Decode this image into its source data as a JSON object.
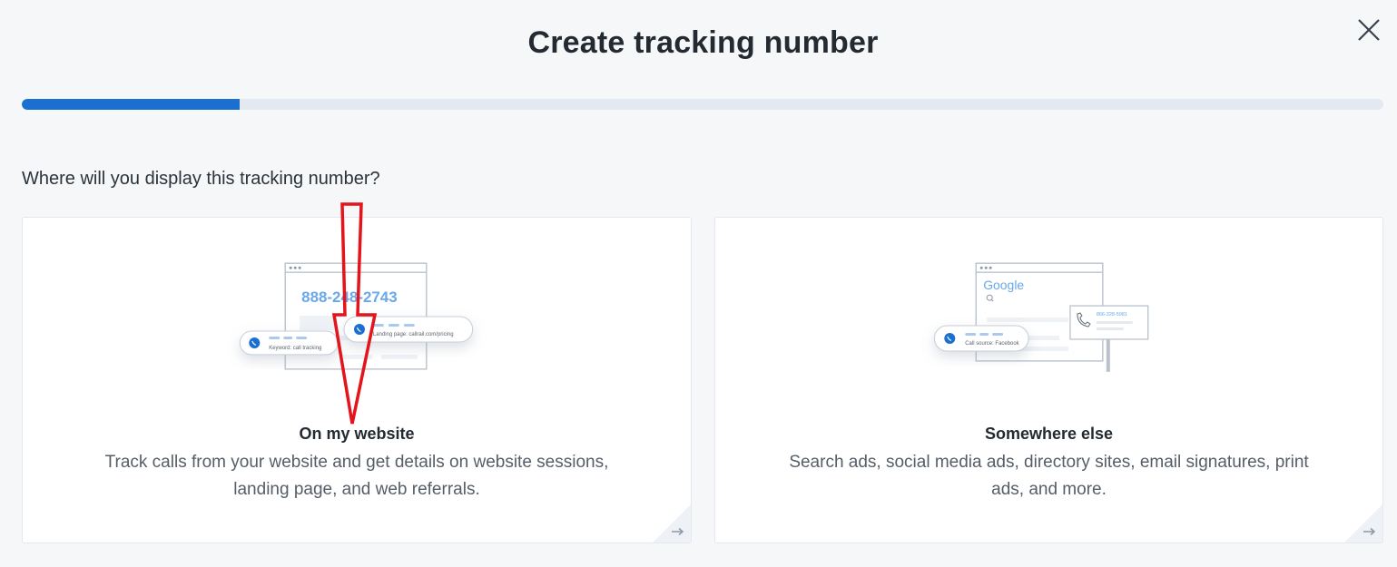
{
  "modal": {
    "title": "Create tracking number",
    "progress_fraction": 0.16
  },
  "question": "Where will you display this tracking number?",
  "options": [
    {
      "title": "On my website",
      "description": "Track calls from your website and get details on website sessions, landing page, and web referrals.",
      "illustration": {
        "phone_number": "888-2¹48-2⁸₈43",
        "number_display": "888-248-2743",
        "chip_1_label": "Keyword: call tracking",
        "chip_2_label": "Landing page: callrail.com/pricing"
      }
    },
    {
      "title": "Somewhere else",
      "description": "Search ads, social media ads, directory sites, email signatures, print ads, and more.",
      "illustration": {
        "brand": "Google",
        "phone_number": "866-328-5981",
        "chip_label": "Call source: Facebook"
      }
    }
  ],
  "colors": {
    "accent": "#1a6fd1",
    "annotation_arrow": "#e3141b",
    "illustration_blue": "#6aa8ea"
  }
}
